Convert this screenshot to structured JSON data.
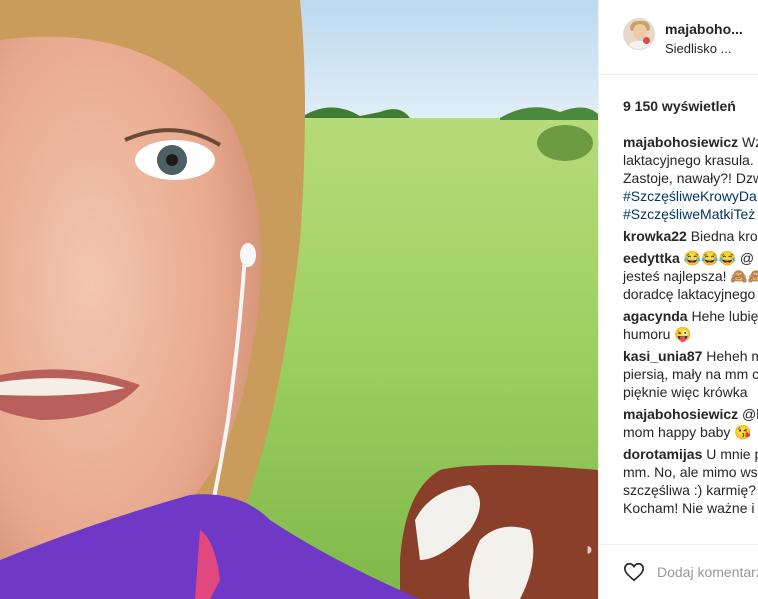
{
  "post": {
    "username": "majaboho...",
    "location": "Siedlisko ...",
    "views": "9 150 wyświetleń"
  },
  "comments": [
    {
      "user": "majabohosiewicz",
      "lines": [
        {
          "text": " Wz",
          "tag": false
        },
        {
          "text": "laktacyjnego krasula.",
          "tag": false
        },
        {
          "text": "Zastoje, nawały?! Dzw",
          "tag": false
        },
        {
          "text": "#SzczęśliweKrowyDa",
          "tag": true
        },
        {
          "text": "#SzczęśliweMatkiTeż",
          "tag": true
        }
      ]
    },
    {
      "user": "krowka22",
      "lines": [
        {
          "text": " Biedna kro",
          "tag": false
        }
      ]
    },
    {
      "user": "eedyttka",
      "lines": [
        {
          "text": " 😂😂😂 @",
          "tag": false
        },
        {
          "text": "jesteś najlepsza! 🙈🙈",
          "tag": false
        },
        {
          "text": "doradcę laktacyjnego",
          "tag": false
        }
      ]
    },
    {
      "user": "agacyndа",
      "lines": [
        {
          "text": " Hehe lubię",
          "tag": false
        },
        {
          "text": "humoru 😜",
          "tag": false
        }
      ]
    },
    {
      "user": "kasi_unia87",
      "lines": [
        {
          "text": " Heheh m",
          "tag": false
        },
        {
          "text": "piersią, mały na mm c",
          "tag": false
        },
        {
          "text": "pięknie więc krówka",
          "tag": false
        }
      ]
    },
    {
      "user": "majabohosiewicz",
      "lines": [
        {
          "text": " @k",
          "tag": false
        },
        {
          "text": "mom happy baby 😘",
          "tag": false
        }
      ]
    },
    {
      "user": "dorotamijas",
      "lines": [
        {
          "text": " U mnie p",
          "tag": false
        },
        {
          "text": "mm. No, ale mimo ws",
          "tag": false
        },
        {
          "text": "szczęśliwa :) karmię?",
          "tag": false
        },
        {
          "text": "Kocham! Nie ważne i",
          "tag": false
        }
      ]
    }
  ],
  "footer": {
    "like_icon": "heart-icon",
    "add_comment_placeholder": "Dodaj komentarz..."
  }
}
